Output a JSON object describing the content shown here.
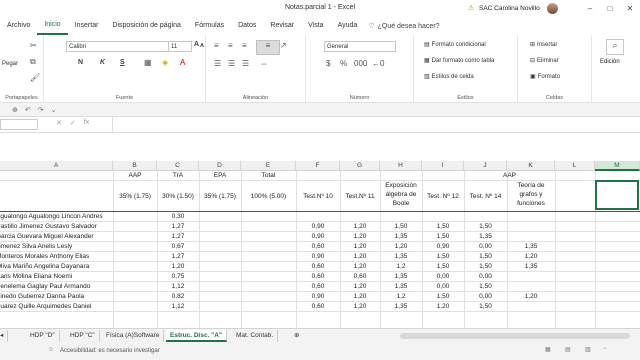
{
  "window": {
    "title": "Notas.parcial 1  -  Excel",
    "user": "SAC Carolina Novillo",
    "min": "–",
    "max": "□",
    "close": "✕"
  },
  "tabs": [
    "Archivo",
    "Inicio",
    "Insertar",
    "Disposición de página",
    "Fórmulas",
    "Datos",
    "Revisar",
    "Vista",
    "Ayuda"
  ],
  "tell_me": "¿Qué desea hacer?",
  "ribbon": {
    "clipboard": {
      "paste": "Pegar",
      "label": "Portapapeles"
    },
    "font": {
      "name": "Calibri",
      "size": "11",
      "bold": "N",
      "italic": "K",
      "underline": "S",
      "label": "Fuente",
      "grow": "A",
      "shrink": "A"
    },
    "alignment": {
      "label": "Alineación"
    },
    "number": {
      "format": "General",
      "label": "Número"
    },
    "styles": {
      "cond": "Formato condicional",
      "table": "Dar formato como tabla",
      "cell": "Estilos de celda",
      "label": "Estilos"
    },
    "cells": {
      "insert": "Insertar",
      "delete": "Eliminar",
      "format": "Formato",
      "label": "Celdas"
    },
    "editing": {
      "label": "Edición"
    }
  },
  "namebox": "",
  "columns": [
    "A",
    "B",
    "C",
    "D",
    "E",
    "F",
    "G",
    "H",
    "I",
    "J",
    "K",
    "L",
    "M"
  ],
  "headers": {
    "b": "AAP",
    "c": "TrA",
    "d": "EPA",
    "e": "Total",
    "aap2": "AAP",
    "b2": "35% (1.75)",
    "c2": "30% (1.50)",
    "d2": "35% (1.75)",
    "e2": "100% (5.00)",
    "f": "Test.Nº 10",
    "g": "Test.Nº 11",
    "h": "Exposición álgebra de Boole",
    "i": "Test. Nº 12",
    "j": "Test. Nº 14",
    "k": "Teoría de grafos y funciones"
  },
  "rows": [
    {
      "name": "Agualongo Agualongo Lincon Andres",
      "c": "0,30",
      "f": "",
      "g": "",
      "h": "",
      "i": "",
      "j": "",
      "k": ""
    },
    {
      "name": "Castillo Jimenez Gustavo Salvador",
      "c": "1,27",
      "f": "0,90",
      "g": "1,20",
      "h": "1,50",
      "i": "1,50",
      "j": "1,50",
      "k": ""
    },
    {
      "name": "Garcia Guevara Miguel Alexander",
      "c": "1,27",
      "f": "0,90",
      "g": "1,20",
      "h": "1,35",
      "i": "1,50",
      "j": "1,35",
      "k": ""
    },
    {
      "name": "Jimenez Silva Anelis Lesly",
      "c": "0,67",
      "f": "0,60",
      "g": "1,20",
      "h": "1,20",
      "i": "0,90",
      "j": "0,00",
      "k": "1,35"
    },
    {
      "name": "Monteros Morales Anthony Elias",
      "c": "1,27",
      "f": "0,90",
      "g": "1,20",
      "h": "1,35",
      "i": "1,50",
      "j": "1,50",
      "k": "1,20"
    },
    {
      "name": "Oliva Mariño Angelina Dayanara",
      "c": "1,20",
      "f": "0,60",
      "g": "1,20",
      "h": "1,2",
      "i": "1,50",
      "j": "1,50",
      "k": "1,35"
    },
    {
      "name": "Paris Molina Eliana Noemi",
      "c": "0,75",
      "f": "0,60",
      "g": "0,60",
      "h": "1,35",
      "i": "0,00",
      "j": "0,00",
      "k": ""
    },
    {
      "name": "Penelema Gaglay Paul Armando",
      "c": "1,12",
      "f": "0,60",
      "g": "1,20",
      "h": "1,35",
      "i": "0,00",
      "j": "1,50",
      "k": ""
    },
    {
      "name": "Pinedo Gutierrez Danna Paola",
      "c": "0,82",
      "f": "0,90",
      "g": "1,20",
      "h": "1,2",
      "i": "1,50",
      "j": "0,00",
      "k": "1,20"
    },
    {
      "name": "Suarez Quille Arquimedes Daniel",
      "c": "1,12",
      "f": "0,60",
      "g": "1,20",
      "h": "1,35",
      "i": "1,20",
      "j": "1,50",
      "k": ""
    }
  ],
  "sheets": [
    "HDP \"D\"",
    "HDP \"C\"",
    "Física (A)Software",
    "Estruc. Disc. \"A\"",
    "Mat. Contab."
  ],
  "active_sheet": 3,
  "status": "Accesibilidad: es necesario investigar"
}
